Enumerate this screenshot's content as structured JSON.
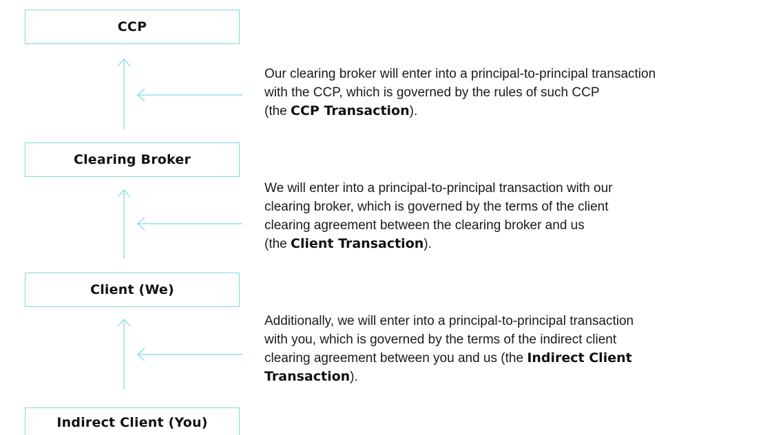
{
  "colors": {
    "connector": "#7fd9da",
    "box_border": "#7fd9da",
    "text": "#1a1a1a"
  },
  "boxes": {
    "ccp": "CCP",
    "clearing_broker": "Clearing Broker",
    "client": "Client (We)",
    "indirect_client": "Indirect Client (You)"
  },
  "descriptions": {
    "ccp_transaction": {
      "line1": "Our clearing broker will enter into a principal-to-principal transaction",
      "line2": "with the CCP, which is governed by the rules of such CCP",
      "line3_pre": "(the ",
      "term": "CCP Transaction",
      "line3_post": ")."
    },
    "client_transaction": {
      "line1": "We will enter into a principal-to-principal transaction with our",
      "line2": "clearing broker, which is governed by the terms of the client",
      "line3": "clearing agreement between the clearing broker and us",
      "line4_pre": "(the ",
      "term": "Client Transaction",
      "line4_post": ")."
    },
    "indirect_client_transaction": {
      "line1": "Additionally, we will enter into a principal-to-principal transaction",
      "line2": "with you, which is governed by the terms of the indirect client",
      "line3_pre": "clearing agreement between you and us (the ",
      "term_part1": "Indirect Client",
      "term_part2": "Transaction",
      "line4_post": ")."
    }
  }
}
